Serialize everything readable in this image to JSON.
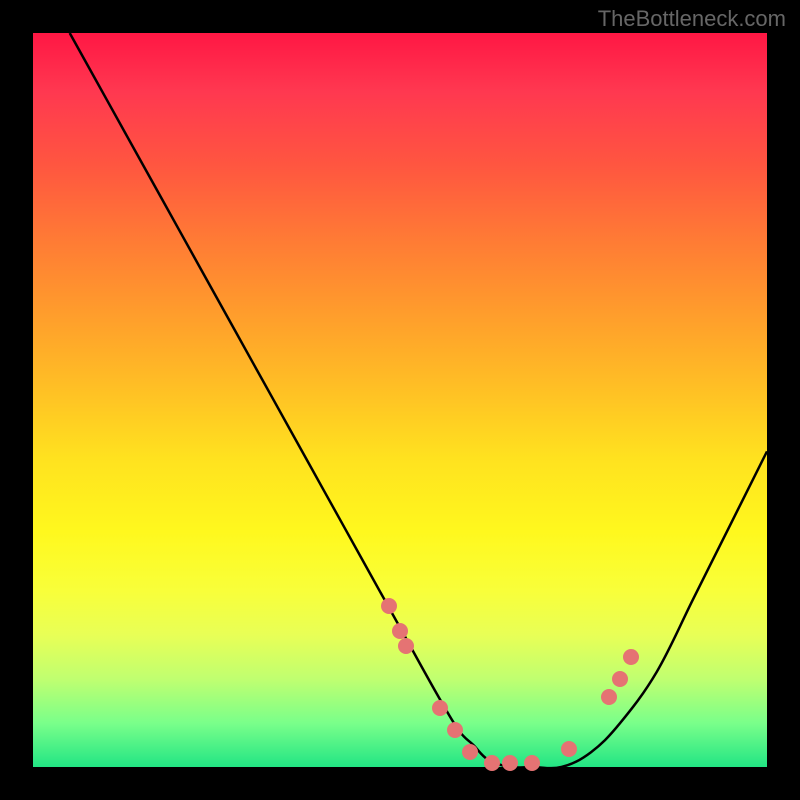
{
  "watermark": "TheBottleneck.com",
  "chart_data": {
    "type": "line",
    "title": "",
    "xlabel": "",
    "ylabel": "",
    "xlim": [
      0,
      100
    ],
    "ylim": [
      0,
      100
    ],
    "grid": false,
    "legend": false,
    "curve": {
      "x": [
        5,
        10,
        15,
        20,
        25,
        30,
        35,
        40,
        45,
        50,
        55,
        58,
        60,
        62,
        65,
        68,
        72,
        76,
        80,
        85,
        90,
        95,
        100
      ],
      "y": [
        100,
        91,
        82,
        73,
        64,
        55,
        46,
        37,
        28,
        19,
        10,
        5,
        3,
        1,
        0,
        0,
        0,
        2,
        6,
        13,
        23,
        33,
        43
      ]
    },
    "series": [
      {
        "name": "data-points",
        "x": [
          48.5,
          50.0,
          50.8,
          55.5,
          57.5,
          59.5,
          62.5,
          65.0,
          68.0,
          73.0,
          78.5,
          80.0,
          81.5
        ],
        "y": [
          22.0,
          18.5,
          16.5,
          8.0,
          5.0,
          2.0,
          0.5,
          0.5,
          0.5,
          2.5,
          9.5,
          12.0,
          15.0
        ]
      }
    ]
  }
}
